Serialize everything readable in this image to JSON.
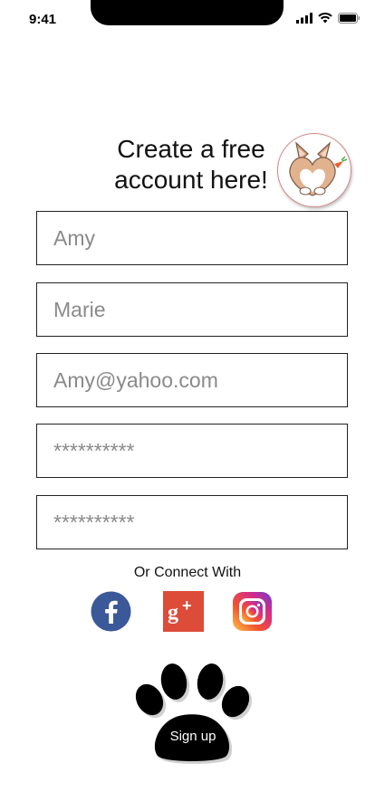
{
  "status_bar": {
    "time": "9:41"
  },
  "header": {
    "title": "Create a free account here!"
  },
  "form": {
    "fields": [
      {
        "placeholder": "Amy"
      },
      {
        "placeholder": "Marie"
      },
      {
        "placeholder": "Amy@yahoo.com"
      },
      {
        "placeholder": "**********"
      },
      {
        "placeholder": "**********"
      }
    ],
    "connect_label": "Or Connect With",
    "signup_label": "Sign up"
  },
  "social": [
    "facebook-icon",
    "google-plus-icon",
    "instagram-icon"
  ],
  "colors": {
    "facebook": "#3b5998",
    "google_plus": "#dd4b39",
    "mascot_border": "#d58a8a"
  }
}
